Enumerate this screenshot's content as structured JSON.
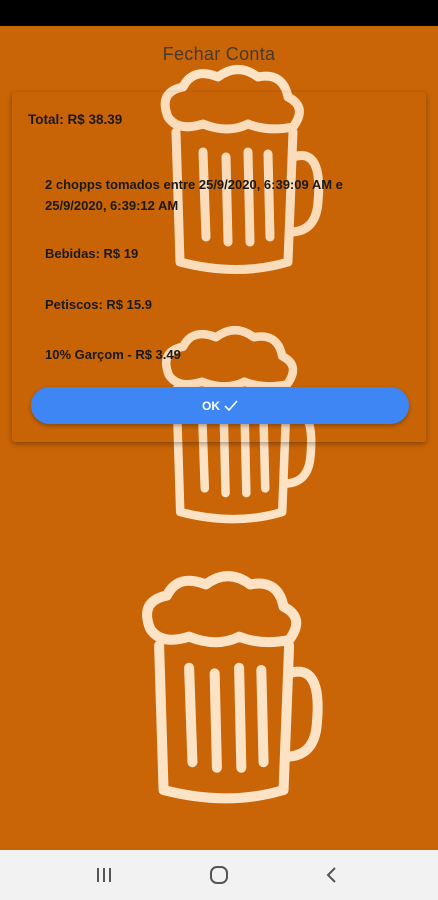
{
  "header": {
    "title": "Fechar Conta"
  },
  "bill": {
    "total": "Total: R$ 38.39",
    "chopps": "2 chopps tomados entre 25/9/2020, 6:39:09 AM e 25/9/2020, 6:39:12 AM",
    "drinks": "Bebidas: R$ 19",
    "snacks": "Petiscos: R$ 15.9",
    "tip": "10% Garçom - R$ 3.49",
    "ok_label": "OK"
  },
  "icons": {
    "ok": "check-icon",
    "background": "beer-mug-icon",
    "nav_recent": "recent-apps-icon",
    "nav_home": "home-icon",
    "nav_back": "back-icon"
  },
  "colors": {
    "background": "#c96507",
    "accent": "#3d86f4",
    "mug": "#fde3c6"
  }
}
